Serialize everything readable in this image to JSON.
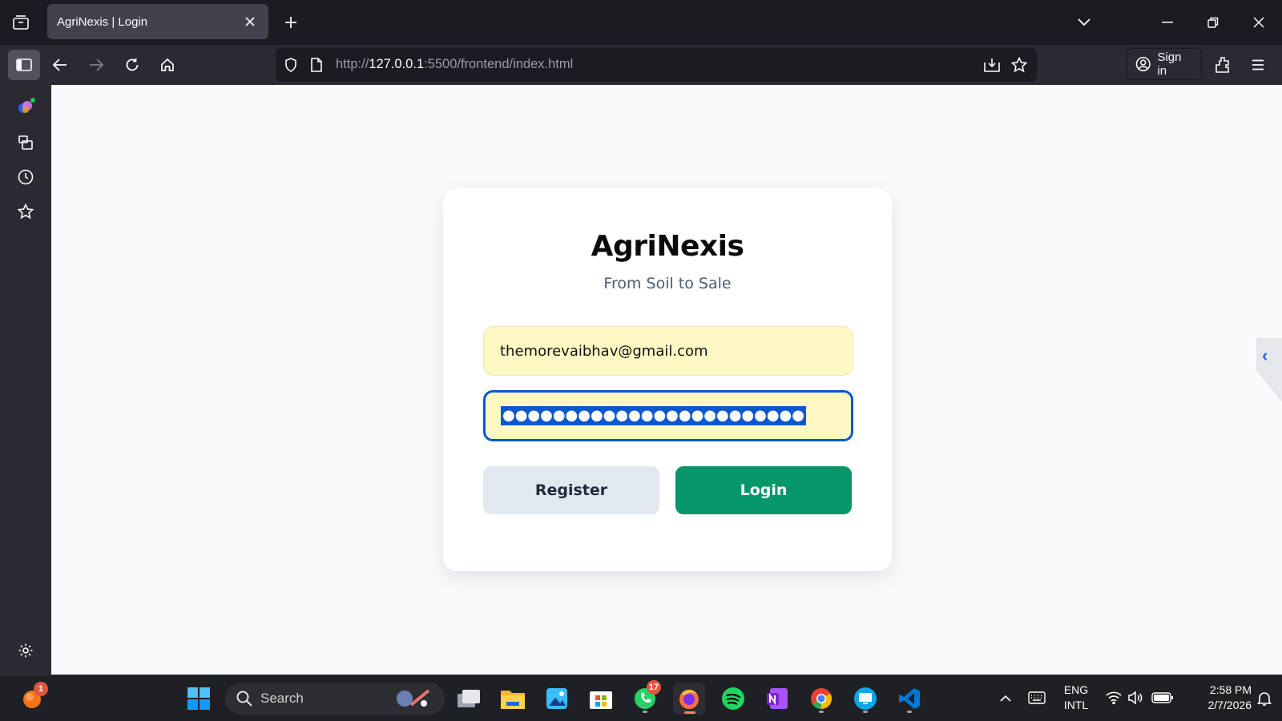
{
  "browser": {
    "tab_title": "AgriNexis | Login",
    "url_scheme": "http://",
    "url_host": "127.0.0.1",
    "url_rest": ":5500/frontend/index.html",
    "signin_label": "Sign in"
  },
  "login": {
    "title": "AgriNexis",
    "subtitle": "From Soil to Sale",
    "email_value": "themorevaibhav@gmail.com",
    "password_mask": "●●●●●●●●●●●●●●●●●●●●●●●●",
    "register_label": "Register",
    "login_label": "Login",
    "accent_color": "#059669",
    "input_color": "#fef9c3"
  },
  "taskbar": {
    "search_placeholder": "Search",
    "notification_badge": "1",
    "whatsapp_badge": "17",
    "language_line1": "ENG",
    "language_line2": "INTL",
    "time": "2:58 PM",
    "date": "2/7/2026"
  }
}
